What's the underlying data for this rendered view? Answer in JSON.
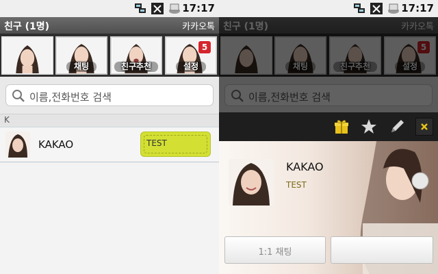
{
  "status_bar": {
    "time": "17:17"
  },
  "header": {
    "title": "친구 (1명)",
    "brand": "카카오톡"
  },
  "tabs": [
    {
      "label": ""
    },
    {
      "label": "채팅"
    },
    {
      "label": "친구추천"
    },
    {
      "label": "설정",
      "badge": "5"
    }
  ],
  "search": {
    "placeholder": "이름,전화번호 검색"
  },
  "friends": {
    "section": "K",
    "items": [
      {
        "name": "KAKAO",
        "status": "TEST"
      }
    ]
  },
  "profile": {
    "name": "KAKAO",
    "status": "TEST",
    "buttons": {
      "chat": "1:1 채팅",
      "other": ""
    },
    "toolbar_icons": [
      "gift-icon",
      "star-icon",
      "pencil-icon",
      "close-icon"
    ]
  },
  "colors": {
    "bubble": "#d3e033",
    "badge": "#d4262c",
    "toolbar_gift": "#e8c21b"
  }
}
